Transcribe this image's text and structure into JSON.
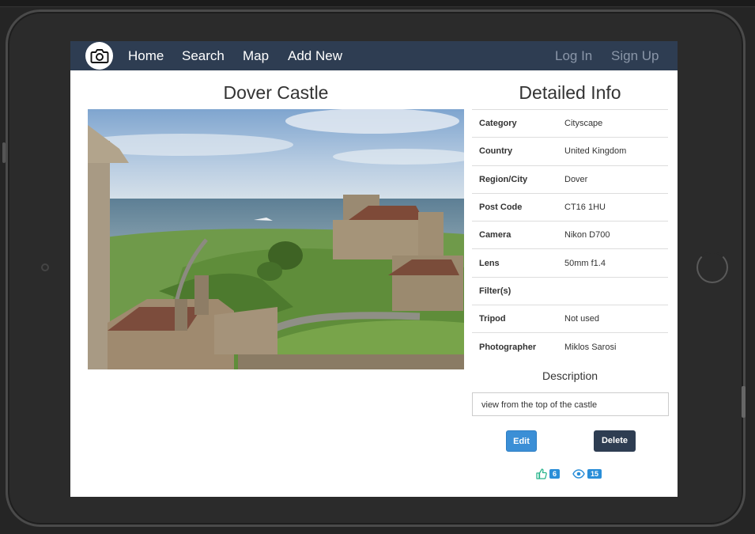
{
  "nav": {
    "links": [
      "Home",
      "Search",
      "Map",
      "Add New"
    ],
    "auth": [
      "Log In",
      "Sign Up"
    ]
  },
  "photo": {
    "title": "Dover Castle"
  },
  "info": {
    "title": "Detailed Info",
    "rows": [
      {
        "key": "Category",
        "value": "Cityscape"
      },
      {
        "key": "Country",
        "value": "United Kingdom"
      },
      {
        "key": "Region/City",
        "value": "Dover"
      },
      {
        "key": "Post Code",
        "value": "CT16 1HU"
      },
      {
        "key": "Camera",
        "value": "Nikon D700"
      },
      {
        "key": "Lens",
        "value": "50mm f1.4"
      },
      {
        "key": "Filter(s)",
        "value": ""
      },
      {
        "key": "Tripod",
        "value": "Not used"
      },
      {
        "key": "Photographer",
        "value": "Miklos Sarosi"
      }
    ],
    "description_title": "Description",
    "description": "view from the top of the castle"
  },
  "actions": {
    "edit": "Edit",
    "delete": "Delete"
  },
  "stats": {
    "likes": "6",
    "views": "15"
  },
  "colors": {
    "nav_bg": "#2e3d52",
    "accent": "#3b8fd6",
    "like_icon": "#2bb58d"
  },
  "icons": [
    "camera-icon",
    "thumbs-up-icon",
    "eye-icon"
  ]
}
